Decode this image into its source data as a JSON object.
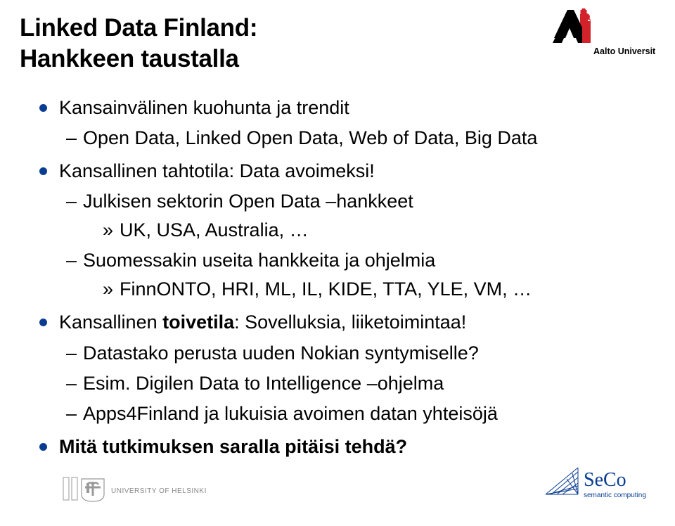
{
  "title": {
    "line1": "Linked Data Finland:",
    "line2": "Hankkeen taustalla"
  },
  "bullets": {
    "b1": {
      "text": "Kansainvälinen kuohunta ja trendit",
      "sub1": "Open Data, Linked Open Data, Web of Data, Big Data"
    },
    "b2": {
      "text": "Kansallinen tahtotila: Data avoimeksi!",
      "sub1": "Julkisen sektorin Open Data –hankkeet",
      "sub1a": "UK, USA, Australia, …",
      "sub2": "Suomessakin useita hankkeita ja ohjelmia",
      "sub2a": "FinnONTO, HRI, ML, IL, KIDE, TTA, YLE, VM, …"
    },
    "b3": {
      "text_prefix": "Kansallinen ",
      "text_strong": "toivetila",
      "text_suffix": ": Sovelluksia, liiketoimintaa!",
      "sub1": "Datastako perusta uuden Nokian syntymiselle?",
      "sub2": "Esim. Digilen Data to Intelligence –ohjelma",
      "sub3": "Apps4Finland ja lukuisia avoimen datan yhteisöjä"
    },
    "b4": {
      "text": "Mitä tutkimuksen saralla pitäisi tehdä?"
    }
  },
  "logos": {
    "aalto_text": "Aalto University",
    "helsinki_text": "UNIVERSITY OF HELSINKI",
    "seco_main": "SeCo",
    "seco_sub": "semantic computing"
  }
}
